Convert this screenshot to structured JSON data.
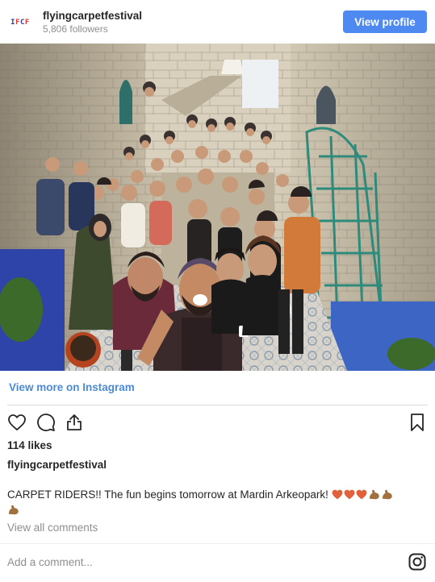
{
  "header": {
    "username": "flyingcarpetfestival",
    "followers": "5,806 followers",
    "view_profile_label": "View profile",
    "avatar_text": "IFCF"
  },
  "photo": {
    "description_icon": "group-selfie-photo"
  },
  "view_more_label": "View more on Instagram",
  "actions": {
    "like_icon": "heart-outline-icon",
    "comment_icon": "comment-bubble-icon",
    "share_icon": "share-upload-icon",
    "save_icon": "bookmark-icon"
  },
  "likes": "114 likes",
  "caption": {
    "username": "flyingcarpetfestival",
    "text": "CARPET RIDERS!! The fun begins tomorrow at Mardin Arkeopark!",
    "emojis": [
      "heart",
      "heart",
      "heart",
      "flexed-biceps",
      "flexed-biceps",
      "flexed-biceps"
    ]
  },
  "view_all_comments": "View all comments",
  "comment": {
    "placeholder": "Add a comment..."
  },
  "colors": {
    "accent_button": "#4e89f1",
    "link": "#4b8bd6",
    "heart_emoji": "#e2613a",
    "biceps_emoji": "#a0703f"
  }
}
